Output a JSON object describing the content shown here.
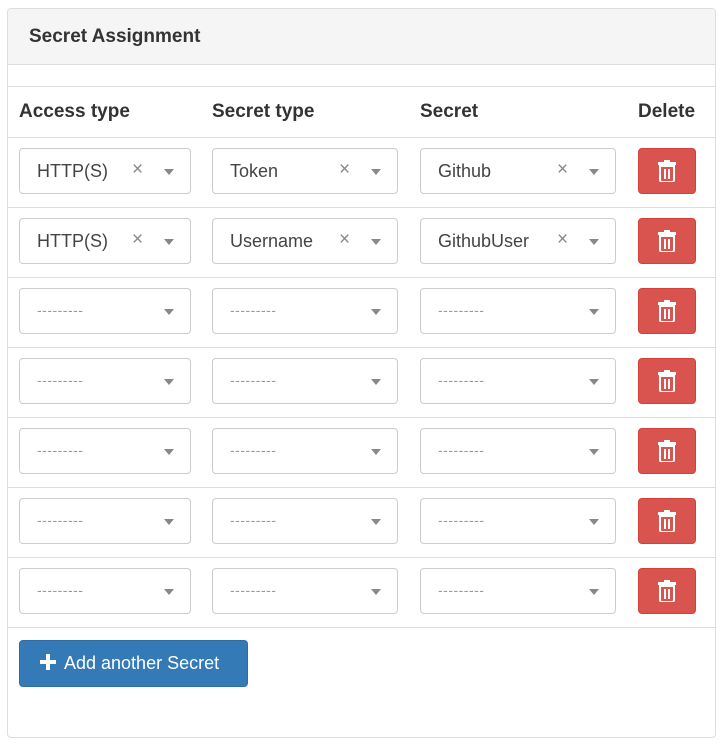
{
  "panel": {
    "title": "Secret Assignment"
  },
  "table": {
    "headers": {
      "access_type": "Access type",
      "secret_type": "Secret type",
      "secret": "Secret",
      "delete": "Delete"
    },
    "rows": [
      {
        "access_type": "HTTP(S)",
        "secret_type": "Token",
        "secret": "Github"
      },
      {
        "access_type": "HTTP(S)",
        "secret_type": "Username",
        "secret": "GithubUser"
      },
      {
        "access_type": "",
        "secret_type": "",
        "secret": ""
      },
      {
        "access_type": "",
        "secret_type": "",
        "secret": ""
      },
      {
        "access_type": "",
        "secret_type": "",
        "secret": ""
      },
      {
        "access_type": "",
        "secret_type": "",
        "secret": ""
      },
      {
        "access_type": "",
        "secret_type": "",
        "secret": ""
      }
    ],
    "placeholder": "---------",
    "clear_glyph": "×"
  },
  "add_button": {
    "label": "Add another Secret"
  },
  "colors": {
    "danger": "#d9534f",
    "primary": "#337ab7",
    "border": "#dddddd",
    "heading_bg": "#f5f5f5"
  },
  "icons": {
    "delete": "trash-icon",
    "add": "plus-icon",
    "dropdown": "caret-down-icon",
    "clear": "clear-icon"
  }
}
